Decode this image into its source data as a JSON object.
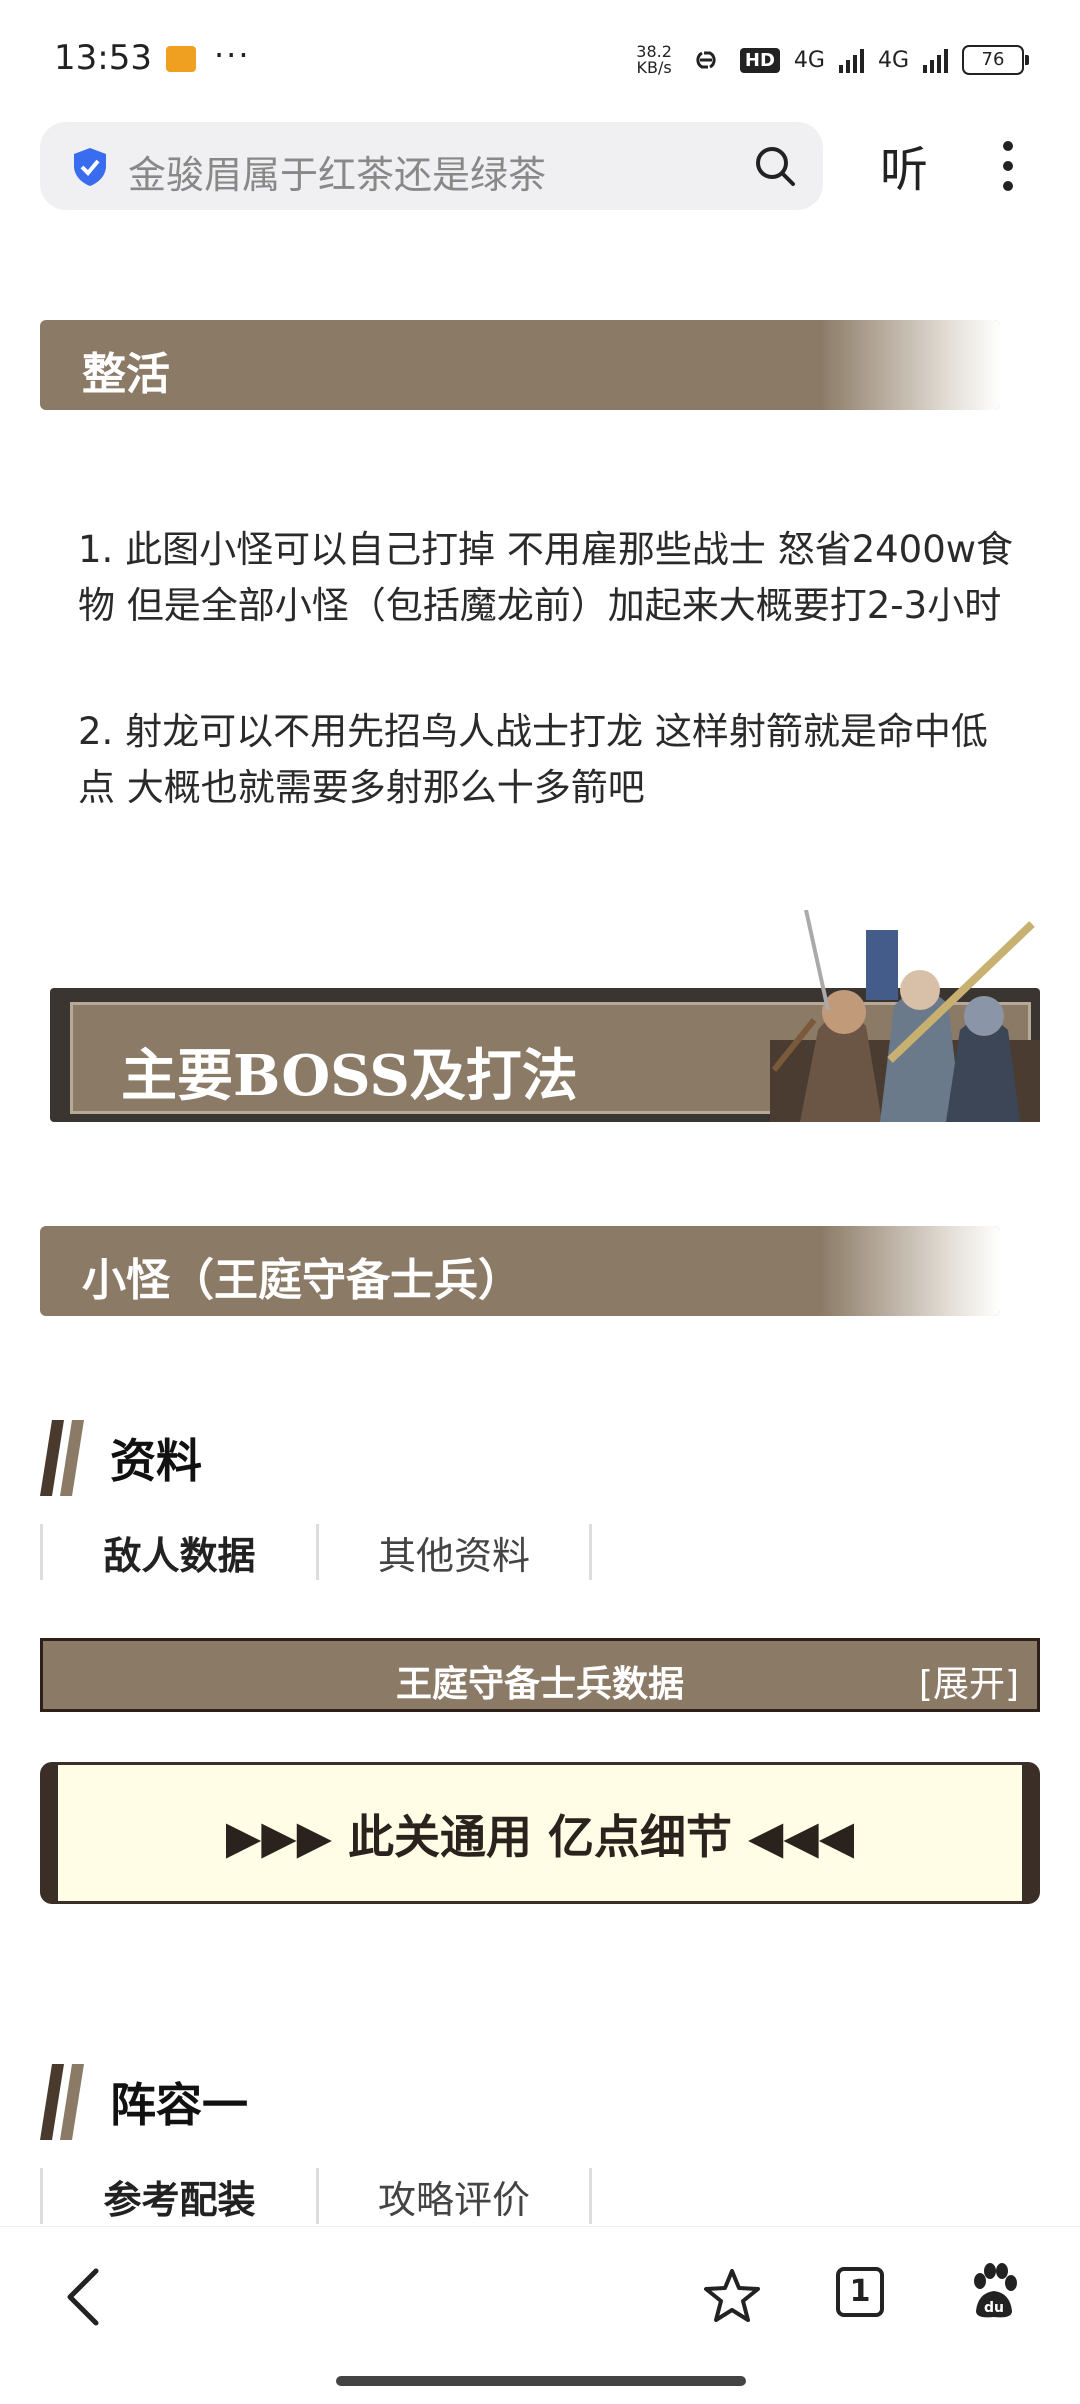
{
  "status_bar": {
    "time": "13:53",
    "dots": "···",
    "net_speed_value": "38.2",
    "net_speed_unit": "KB/s",
    "hd_label": "HD",
    "net1": "4G",
    "net2": "4G",
    "battery": "76"
  },
  "search": {
    "query": "金骏眉属于红茶还是绿茶",
    "listen_label": "听"
  },
  "sections": {
    "tips_title": "整活",
    "tips": [
      "1. 此图小怪可以自己打掉 不用雇那些战士 怒省2400w食物 但是全部小怪（包括魔龙前）加起来大概要打2-3小时",
      "2. 射龙可以不用先招鸟人战士打龙 这样射箭就是命中低点 大概也就需要多射那么十多箭吧"
    ],
    "boss_title": "主要BOSS及打法",
    "minion_title": "小怪（王庭守备士兵）",
    "info_heading": "资料",
    "info_tabs": [
      "敌人数据",
      "其他资料"
    ],
    "data_bar_title": "王庭守备士兵数据",
    "data_bar_expand": "[展开]",
    "tip_box": "▶▶▶ 此关通用 亿点细节 ◀◀◀",
    "lineup_heading": "阵容一",
    "lineup_tabs": [
      "参考配装",
      "攻略评价"
    ]
  },
  "bottom_nav": {
    "tab_count": "1"
  },
  "colors": {
    "banner": "#8b7a66",
    "dark_brown": "#3a2e26",
    "tip_bg": "#fffde6"
  }
}
